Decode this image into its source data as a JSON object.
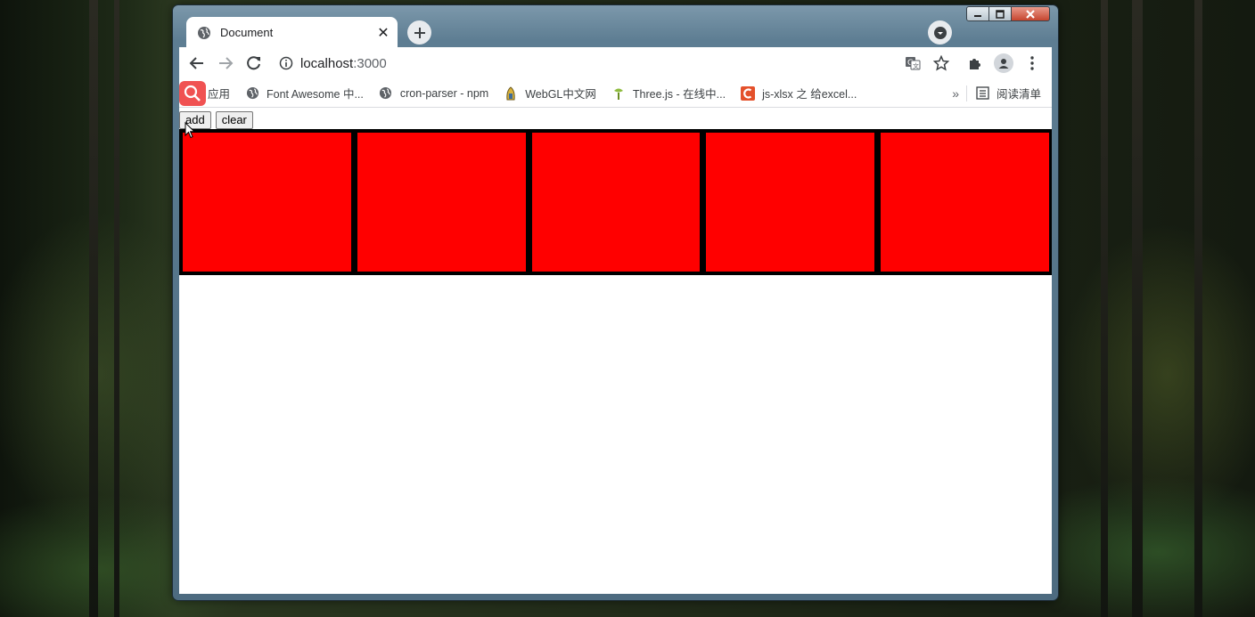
{
  "browser": {
    "tab": {
      "title": "Document",
      "close_glyph": "✕"
    },
    "address_bar": {
      "host": "localhost",
      "port": ":3000"
    },
    "bookmarks": [
      {
        "label": "应用",
        "icon": "apps-grid-icon"
      },
      {
        "label": "Font Awesome 中...",
        "icon": "globe-icon"
      },
      {
        "label": "cron-parser - npm",
        "icon": "globe-icon"
      },
      {
        "label": "WebGL中文网",
        "icon": "webgl-icon"
      },
      {
        "label": "Three.js - 在线中...",
        "icon": "threejs-icon"
      },
      {
        "label": "js-xlsx 之 给excel...",
        "icon": "csdn-icon"
      }
    ],
    "bookmarks_overflow": "»",
    "reading_list": "阅读清单"
  },
  "page": {
    "add_label": "add",
    "clear_label": "clear",
    "boxes": 5,
    "box_color": "#ff0000",
    "row_background": "#000000"
  }
}
